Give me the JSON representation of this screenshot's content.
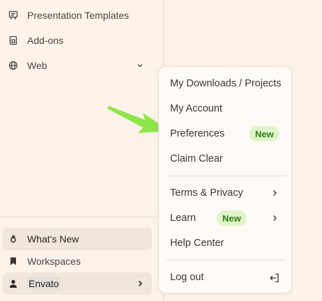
{
  "sidebar": {
    "top_items": [
      {
        "label": "Presentation Templates",
        "icon": "presentation-icon"
      },
      {
        "label": "Add-ons",
        "icon": "addon-icon"
      },
      {
        "label": "Web",
        "icon": "globe-icon"
      }
    ],
    "bottom_items": [
      {
        "label": "What's New",
        "icon": "flame-icon"
      },
      {
        "label": "Workspaces",
        "icon": "bookmark-icon"
      }
    ],
    "account": {
      "label": "Envato",
      "icon": "user-icon"
    }
  },
  "menu": {
    "items": [
      {
        "label": "My Downloads / Projects"
      },
      {
        "label": "My Account"
      },
      {
        "label": "Preferences",
        "badge": "New"
      },
      {
        "label": "Claim Clear"
      },
      {
        "label": "Terms & Privacy"
      },
      {
        "label": "Learn",
        "badge": "New"
      },
      {
        "label": "Help Center"
      },
      {
        "label": "Log out"
      }
    ]
  },
  "colors": {
    "background": "#fdf3ea",
    "badge_bg": "#dff5c8",
    "badge_text": "#2f7a17",
    "arrow": "#8ee64a"
  }
}
